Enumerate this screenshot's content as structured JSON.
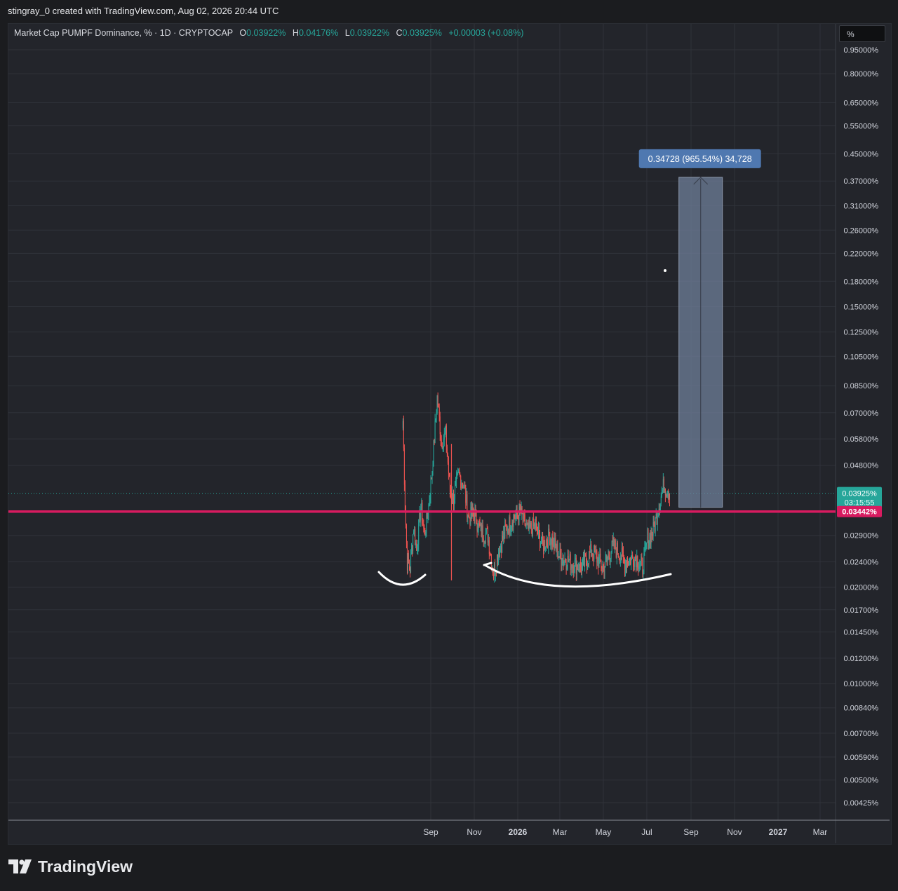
{
  "credit": "stingray_0 created with TradingView.com, Aug 02, 2026 20:44 UTC",
  "brand": {
    "name": "TradingView"
  },
  "scale_button": {
    "label": "%"
  },
  "legend": {
    "symbol": "Market Cap PUMPF Dominance, % · 1D · CRYPTOCAP",
    "open_key": "O",
    "open": "0.03922%",
    "high_key": "H",
    "high": "0.04176%",
    "low_key": "L",
    "low": "0.03922%",
    "close_key": "C",
    "close": "0.03925%",
    "change": "+0.00003 (+0.08%)"
  },
  "colors": {
    "up": "#26a69a",
    "down": "#ef5350",
    "horizontal_line": "#d81b60",
    "measure_box": "#6f7f99",
    "measure_label": "#4f78b0"
  },
  "icons": [
    "tradingview-logo-icon",
    "measure-arrow-icon"
  ],
  "chart_data": {
    "type": "candlestick",
    "scale": "log",
    "y_tick_labels": [
      "0.95000%",
      "0.80000%",
      "0.65000%",
      "0.55000%",
      "0.45000%",
      "0.37000%",
      "0.31000%",
      "0.26000%",
      "0.22000%",
      "0.18000%",
      "0.15000%",
      "0.12500%",
      "0.10500%",
      "0.08500%",
      "0.07000%",
      "0.05800%",
      "0.04800%",
      "0.02900%",
      "0.02400%",
      "0.02000%",
      "0.01700%",
      "0.01450%",
      "0.01200%",
      "0.01000%",
      "0.00840%",
      "0.00700%",
      "0.00590%",
      "0.00500%",
      "0.00425%"
    ],
    "y_tick_values": [
      0.95,
      0.8,
      0.65,
      0.55,
      0.45,
      0.37,
      0.31,
      0.26,
      0.22,
      0.18,
      0.15,
      0.125,
      0.105,
      0.085,
      0.07,
      0.058,
      0.048,
      0.029,
      0.024,
      0.02,
      0.017,
      0.0145,
      0.012,
      0.01,
      0.0084,
      0.007,
      0.0059,
      0.005,
      0.00425
    ],
    "x_tick_labels": [
      "Sep",
      "Nov",
      "2026",
      "Mar",
      "May",
      "Jul",
      "Sep",
      "Nov",
      "2027",
      "Mar"
    ],
    "x_tick_bold": [
      false,
      false,
      true,
      false,
      false,
      false,
      false,
      false,
      true,
      false
    ],
    "x_tick_dates": [
      "2025-09-01",
      "2025-11-01",
      "2026-01-01",
      "2026-03-01",
      "2026-05-01",
      "2026-07-01",
      "2026-09-01",
      "2026-11-01",
      "2027-01-01",
      "2027-03-01"
    ],
    "series_anchors": [
      [
        "2025-07-24",
        0.066
      ],
      [
        "2025-07-27",
        0.036
      ],
      [
        "2025-07-30",
        0.024
      ],
      [
        "2025-08-03",
        0.023
      ],
      [
        "2025-08-08",
        0.031
      ],
      [
        "2025-08-12",
        0.026
      ],
      [
        "2025-08-18",
        0.036
      ],
      [
        "2025-08-23",
        0.029
      ],
      [
        "2025-08-28",
        0.034
      ],
      [
        "2025-09-03",
        0.047
      ],
      [
        "2025-09-10",
        0.078
      ],
      [
        "2025-09-16",
        0.057
      ],
      [
        "2025-09-22",
        0.06
      ],
      [
        "2025-09-28",
        0.04
      ],
      [
        "2025-10-03",
        0.038
      ],
      [
        "2025-10-10",
        0.045
      ],
      [
        "2025-10-17",
        0.042
      ],
      [
        "2025-10-24",
        0.033
      ],
      [
        "2025-11-01",
        0.034
      ],
      [
        "2025-11-10",
        0.03
      ],
      [
        "2025-11-20",
        0.029
      ],
      [
        "2025-11-28",
        0.022
      ],
      [
        "2025-12-05",
        0.026
      ],
      [
        "2025-12-15",
        0.03
      ],
      [
        "2025-12-25",
        0.033
      ],
      [
        "2026-01-05",
        0.034
      ],
      [
        "2026-01-15",
        0.03
      ],
      [
        "2026-01-25",
        0.031
      ],
      [
        "2026-02-05",
        0.027
      ],
      [
        "2026-02-15",
        0.029
      ],
      [
        "2026-03-01",
        0.025
      ],
      [
        "2026-03-15",
        0.024
      ],
      [
        "2026-04-01",
        0.023
      ],
      [
        "2026-04-15",
        0.026
      ],
      [
        "2026-05-01",
        0.023
      ],
      [
        "2026-05-15",
        0.027
      ],
      [
        "2026-06-01",
        0.024
      ],
      [
        "2026-06-15",
        0.025
      ],
      [
        "2026-06-25",
        0.023
      ],
      [
        "2026-07-02",
        0.028
      ],
      [
        "2026-07-10",
        0.03
      ],
      [
        "2026-07-18",
        0.036
      ],
      [
        "2026-07-25",
        0.0418
      ],
      [
        "2026-08-02",
        0.03925
      ]
    ],
    "wick_spike": {
      "date": "2025-09-30",
      "high": 0.056,
      "low": 0.021
    },
    "horizontal_line": {
      "value": 0.03442,
      "label": "0.03442%"
    },
    "last_price": {
      "value": 0.03925,
      "label": "0.03925%",
      "countdown": "03:15:55"
    },
    "measure": {
      "start_date": "2026-08-15",
      "end_date": "2026-10-15",
      "from": 0.0355,
      "to": 0.38,
      "label": "0.34728 (965.54%) 34,728"
    }
  }
}
